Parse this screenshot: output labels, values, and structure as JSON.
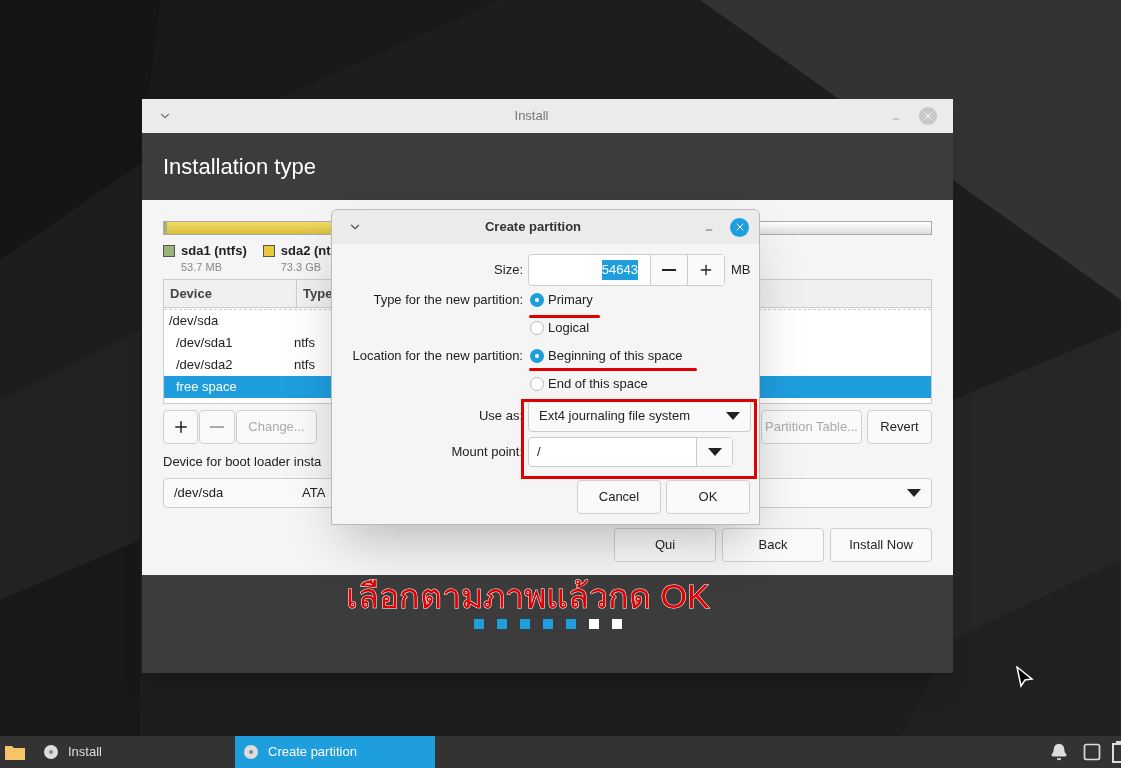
{
  "main_window": {
    "title": "Install",
    "heading": "Installation type",
    "partition_legend": [
      {
        "name": "sda1 (ntfs)",
        "size": "53.7 MB",
        "color": "#9bb37a"
      },
      {
        "name": "sda2 (nt",
        "size": "73.3 GB",
        "color": "#e8c93b"
      }
    ],
    "table": {
      "columns": [
        "Device",
        "Type"
      ],
      "rows": [
        {
          "device": "/dev/sda",
          "selected": false,
          "children": [
            {
              "device": "/dev/sda1",
              "type": "ntfs",
              "selected": false
            },
            {
              "device": "/dev/sda2",
              "type": "ntfs",
              "selected": false
            },
            {
              "device": "free space",
              "selected": true
            }
          ]
        }
      ]
    },
    "partition_buttons": [
      {
        "kind": "add",
        "disabled": false
      },
      {
        "kind": "remove",
        "disabled": true
      },
      {
        "kind": "text",
        "label": "Change...",
        "disabled": true
      }
    ],
    "table_buttons": [
      {
        "label": "Partition Table...",
        "disabled": true
      },
      {
        "label": "Revert",
        "disabled": false
      }
    ],
    "boot_loader": {
      "label": "Device for boot loader insta",
      "device": "/dev/sda",
      "model": "ATA"
    },
    "nav_buttons": [
      "Qui",
      "Back",
      "Install Now"
    ],
    "steps": [
      {
        "done": true
      },
      {
        "done": true
      },
      {
        "done": true
      },
      {
        "done": true
      },
      {
        "done": true
      },
      {
        "done": false
      },
      {
        "done": false
      }
    ]
  },
  "dialog": {
    "title": "Create partition",
    "size": {
      "label": "Size:",
      "value": "54643",
      "unit": "MB"
    },
    "type": {
      "label": "Type for the new partition:",
      "options": [
        {
          "label": "Primary",
          "selected": true
        },
        {
          "label": "Logical",
          "selected": false
        }
      ]
    },
    "location": {
      "label": "Location for the new partition:",
      "options": [
        {
          "label": "Beginning of this space",
          "selected": true
        },
        {
          "label": "End of this space",
          "selected": false
        }
      ]
    },
    "use_as": {
      "label": "Use as:",
      "value": "Ext4 journaling file system"
    },
    "mount_point": {
      "label": "Mount point:",
      "value": "/"
    },
    "buttons": [
      "Cancel",
      "OK"
    ]
  },
  "annotation": {
    "text": "เลือกตามภาพแล้วกด OK"
  },
  "taskbar": {
    "items": [
      {
        "label": "Install",
        "selected": false
      },
      {
        "label": "Create partition",
        "selected": true
      }
    ]
  }
}
